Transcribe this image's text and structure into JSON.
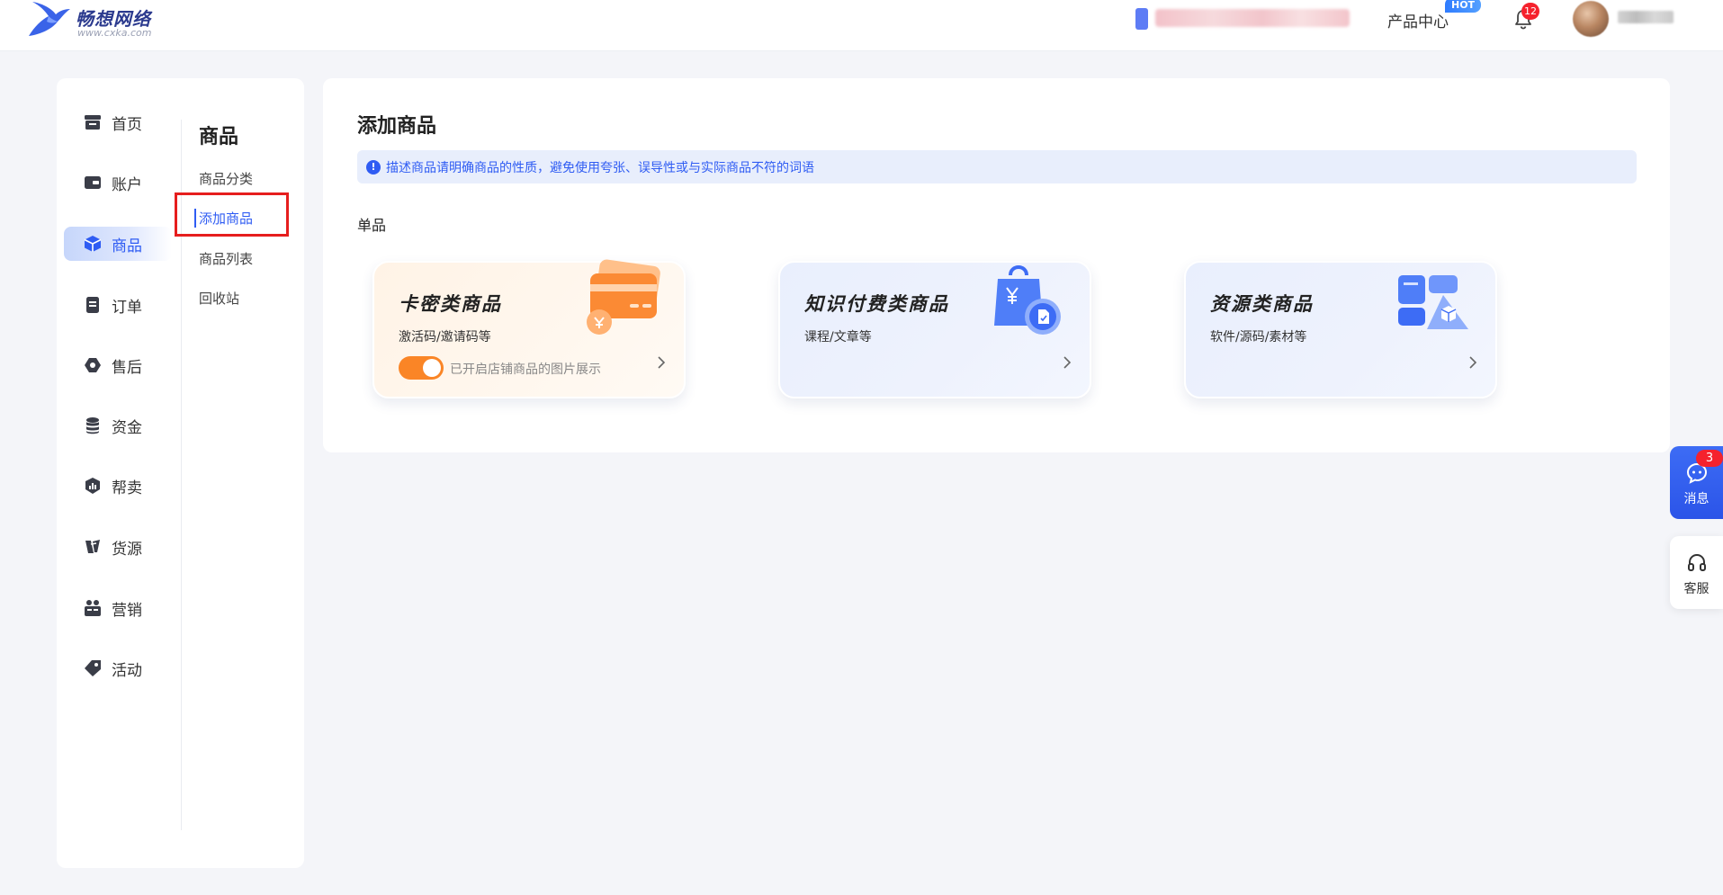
{
  "header": {
    "brand_name": "畅想网络",
    "brand_url": "www.cxka.com",
    "product_center": "产品中心",
    "hot_badge": "HOT",
    "notification_count": "12"
  },
  "sidebar": {
    "items": [
      {
        "label": "首页",
        "icon": "store-icon"
      },
      {
        "label": "账户",
        "icon": "wallet-icon"
      },
      {
        "label": "商品",
        "icon": "cube-icon",
        "active": true
      },
      {
        "label": "订单",
        "icon": "order-icon"
      },
      {
        "label": "售后",
        "icon": "after-sales-icon"
      },
      {
        "label": "资金",
        "icon": "coins-icon"
      },
      {
        "label": "帮卖",
        "icon": "shield-chart-icon"
      },
      {
        "label": "货源",
        "icon": "supply-icon"
      },
      {
        "label": "营销",
        "icon": "marketing-icon"
      },
      {
        "label": "活动",
        "icon": "tag-icon"
      }
    ]
  },
  "subnav": {
    "title": "商品",
    "items": [
      {
        "label": "商品分类"
      },
      {
        "label": "添加商品",
        "active": true
      },
      {
        "label": "商品列表"
      },
      {
        "label": "回收站"
      }
    ]
  },
  "main": {
    "title": "添加商品",
    "notice": "描述商品请明确商品的性质，避免使用夸张、误导性或与实际商品不符的词语",
    "section_label": "单品",
    "cards": [
      {
        "title": "卡密类商品",
        "subtitle": "激活码/邀请码等",
        "toggle_label": "已开启店铺商品的图片展示",
        "toggle_on": true
      },
      {
        "title": "知识付费类商品",
        "subtitle": "课程/文章等"
      },
      {
        "title": "资源类商品",
        "subtitle": "软件/源码/素材等"
      }
    ]
  },
  "floating": {
    "message_label": "消息",
    "message_count": "3",
    "service_label": "客服"
  },
  "colors": {
    "primary": "#2f5cf3",
    "toggle_orange": "#fa8526",
    "badge_red": "#f5222d",
    "highlight_red": "#e61e1e"
  }
}
